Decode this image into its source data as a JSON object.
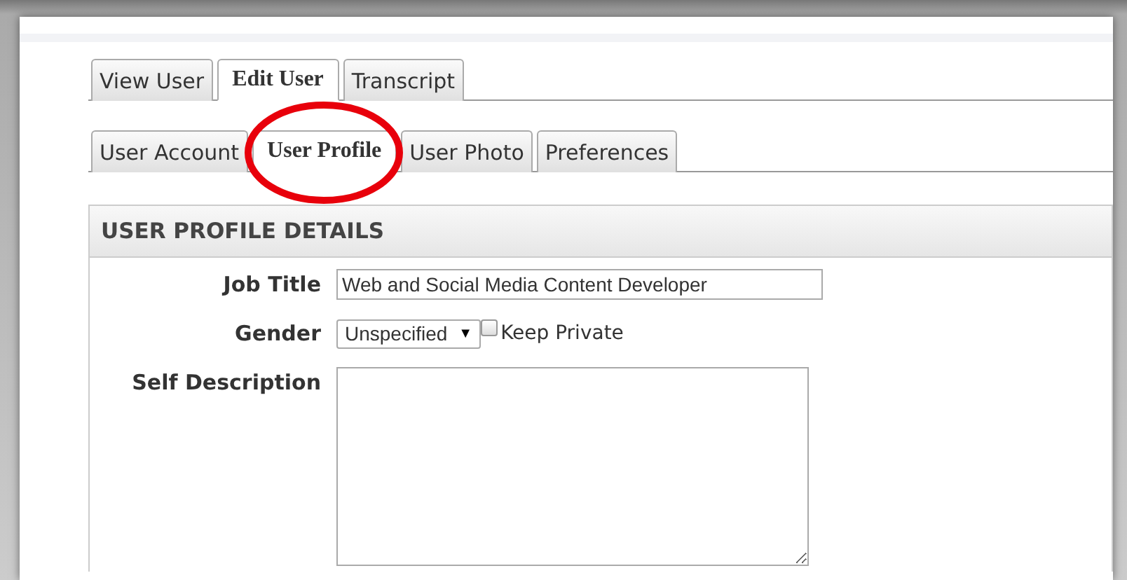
{
  "main_tabs": [
    {
      "label": "View User",
      "selected": false
    },
    {
      "label": "Edit User",
      "selected": true
    },
    {
      "label": "Transcript",
      "selected": false
    }
  ],
  "sub_tabs": [
    {
      "label": "User Account",
      "selected": false
    },
    {
      "label": "User Profile",
      "selected": true
    },
    {
      "label": "User Photo",
      "selected": false
    },
    {
      "label": "Preferences",
      "selected": false
    }
  ],
  "section": {
    "title": "USER PROFILE DETAILS",
    "fields": [
      {
        "kind": "text",
        "label": "Job Title",
        "value": "Web and Social Media Content Developer"
      },
      {
        "kind": "select",
        "label": "Gender",
        "value": "Unspecified",
        "arrow": "▼",
        "checkbox": {
          "label": "Keep Private",
          "checked": false
        }
      },
      {
        "kind": "textarea",
        "label": "Self Description"
      }
    ]
  }
}
